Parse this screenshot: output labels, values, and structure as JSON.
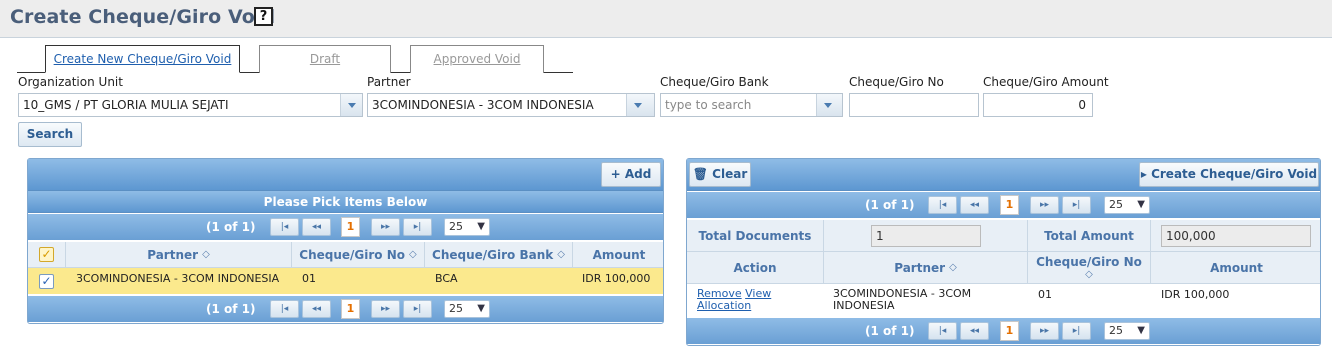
{
  "page": {
    "title": "Create Cheque/Giro Void",
    "help_label": "?"
  },
  "tabs": [
    {
      "label": "Create New Cheque/Giro Void"
    },
    {
      "label": "Draft"
    },
    {
      "label": "Approved Void"
    }
  ],
  "filters": {
    "org_unit": {
      "label": "Organization Unit",
      "value": "10_GMS / PT GLORIA MULIA SEJATI"
    },
    "partner": {
      "label": "Partner",
      "value": "3COMINDONESIA - 3COM INDONESIA"
    },
    "bank": {
      "label": "Cheque/Giro Bank",
      "placeholder": "type to search"
    },
    "cheque_no": {
      "label": "Cheque/Giro No",
      "value": ""
    },
    "amount": {
      "label": "Cheque/Giro Amount",
      "value": "0"
    },
    "search_label": "Search"
  },
  "left_panel": {
    "add_label": "+ Add",
    "title": "Please Pick Items Below",
    "page_info": "(1 of 1)",
    "current_page": "1",
    "page_size": "25",
    "columns": [
      "Partner",
      "Cheque/Giro No",
      "Cheque/Giro Bank",
      "Amount"
    ],
    "rows": [
      {
        "partner": "3COMINDONESIA - 3COM INDONESIA",
        "cheque_no": "01",
        "bank": "BCA",
        "amount": "IDR 100,000",
        "checked": true
      }
    ]
  },
  "right_panel": {
    "clear_label": "Clear",
    "create_label": "Create Cheque/Giro Void",
    "page_info": "(1 of 1)",
    "current_page": "1",
    "page_size": "25",
    "total_documents_label": "Total Documents",
    "total_documents_value": "1",
    "total_amount_label": "Total Amount",
    "total_amount_value": "100,000",
    "columns": [
      "Action",
      "Partner",
      "Cheque/Giro No",
      "Amount"
    ],
    "rows": [
      {
        "remove_label": "Remove",
        "view_label": "View",
        "allocation_label": "Allocation",
        "partner": "3COMINDONESIA - 3COM INDONESIA",
        "cheque_no": "01",
        "amount": "IDR 100,000"
      }
    ]
  },
  "pager_icons": {
    "first": "|◂",
    "prev": "◂◂",
    "next": "▸▸",
    "last": "▸|"
  },
  "colors": {
    "accent": "#4a5e7a",
    "bar": "#6ea3d6",
    "selected_row": "#fbe98d",
    "link": "#1f5fae"
  }
}
